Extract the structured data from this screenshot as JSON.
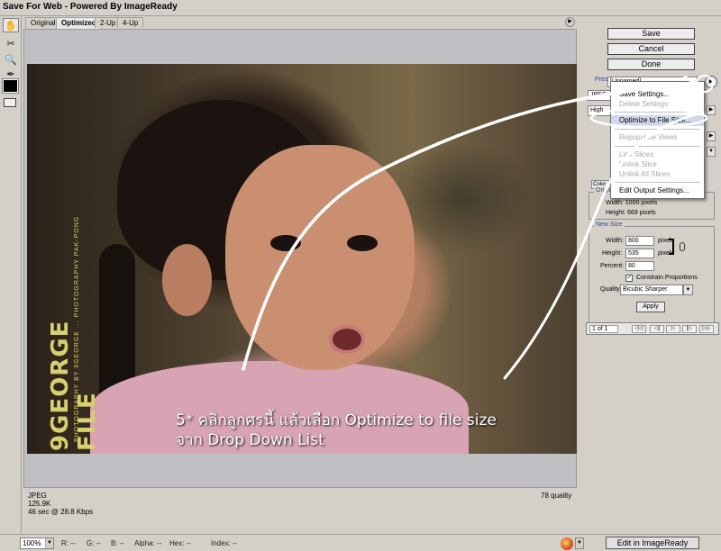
{
  "window": {
    "title": "Save For Web - Powered By ImageReady"
  },
  "tabs": [
    {
      "label": "Original"
    },
    {
      "label": "Optimized"
    },
    {
      "label": "2-Up"
    },
    {
      "label": "4-Up"
    }
  ],
  "tools": [
    {
      "icon": "hand-icon",
      "glyph": "✋"
    },
    {
      "icon": "slice-select-icon",
      "glyph": "✂"
    },
    {
      "icon": "zoom-icon",
      "glyph": "🔍"
    },
    {
      "icon": "eyedropper-icon",
      "glyph": "✒"
    }
  ],
  "preview": {
    "watermark_big": "9GEORGE FILE",
    "watermark_small": "PHOTOGRAPHY BY 9GEORGE ... PHOTOGRAPHY PAK-PONG",
    "caption_line1": "5* คลิกลูกศรนี้ แล้วเลือก Optimize to file size",
    "caption_line2": "จาก Drop Down List"
  },
  "status": {
    "format": "JPEG",
    "size": "125.9K",
    "time": "46 sec @ 28.8 Kbps",
    "quality": "78 quality"
  },
  "bottom": {
    "zoom": "100%",
    "r": "R: --",
    "g": "G: --",
    "b": "B: --",
    "alpha": "Alpha: --",
    "hex": "Hex: --",
    "index": "Index: --",
    "edit_button": "Edit in ImageReady"
  },
  "panel": {
    "save": "Save",
    "cancel": "Cancel",
    "done": "Done",
    "preset_label": "Preset:",
    "preset_value": "[Unnamed]",
    "format_value": "JPEG",
    "quality_value": "High",
    "color_tab": "Color",
    "original_size_title": "Original Size",
    "orig_width": "Width: 1000 pixels",
    "orig_height": "Height: 669 pixels",
    "new_size_title": "New Size",
    "width_label": "Width:",
    "width_value": "800",
    "height_label": "Height:",
    "height_value": "535",
    "percent_label": "Percent:",
    "percent_value": "80",
    "unit": "pixels",
    "constrain": "Constrain Proportions",
    "quality_label": "Quality:",
    "quality_method": "Bicubic Sharper",
    "apply": "Apply",
    "frame": "1 of 1"
  },
  "menu": {
    "items": [
      {
        "label": "Save Settings...",
        "enabled": true
      },
      {
        "label": "Delete Settings",
        "enabled": false
      },
      {
        "label": "Optimize to File Size...",
        "enabled": true
      },
      {
        "label": "Repopulate Views",
        "enabled": false
      },
      {
        "label": "Link Slices",
        "enabled": false
      },
      {
        "label": "Unlink Slice",
        "enabled": false
      },
      {
        "label": "Unlink All Slices",
        "enabled": false
      },
      {
        "label": "Edit Output Settings...",
        "enabled": true
      }
    ]
  },
  "colors": {
    "chrome": "#d4d0c8",
    "accent": "#2050a0",
    "highlight": "#cfd8ea"
  }
}
